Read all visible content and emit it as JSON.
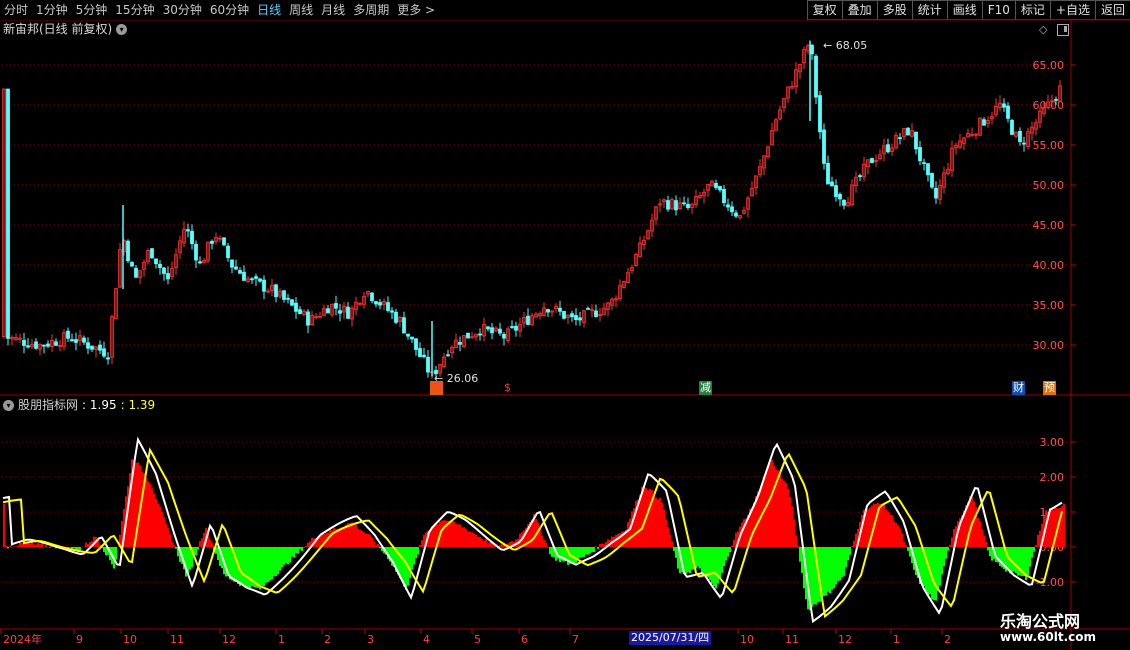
{
  "toolbar": {
    "periods": [
      "分时",
      "1分钟",
      "5分钟",
      "15分钟",
      "30分钟",
      "60分钟",
      "日线",
      "周线",
      "月线",
      "多周期",
      "更多"
    ],
    "active_period": "日线",
    "more_arrow": ">",
    "right_buttons": [
      "复权",
      "叠加",
      "多股",
      "统计",
      "画线",
      "F10",
      "标记",
      "+自选",
      "返回"
    ]
  },
  "stock": {
    "title": "新宙邦(日线 前复权)",
    "high_label": "68.05",
    "low_label": "26.06"
  },
  "events": [
    {
      "label": "激",
      "color": "#ff4040",
      "bg": "#e06000"
    },
    {
      "label": "$",
      "color": "#ff3030",
      "bg": "transparent"
    },
    {
      "label": "减",
      "color": "#ffffff",
      "bg": "#208040"
    },
    {
      "label": "财",
      "color": "#ffffff",
      "bg": "#1050b0"
    },
    {
      "label": "预",
      "color": "#ffffff",
      "bg": "#e07000"
    }
  ],
  "indicator": {
    "name": "股朋指标网",
    "value1": ": 1.95",
    "value2": ": 1.39"
  },
  "price_axis": {
    "ticks": [
      "65.00",
      "60.00",
      "55.00",
      "50.00",
      "45.00",
      "40.00",
      "35.00",
      "30.00"
    ],
    "color": "#ff5050"
  },
  "ind_axis": {
    "ticks": [
      "3.00",
      "2.00",
      "1.00",
      "0.00",
      "-1.00"
    ]
  },
  "date_axis": {
    "labels": [
      "2024年",
      "9",
      "10",
      "11",
      "12",
      "1",
      "2",
      "3",
      "4",
      "5",
      "6",
      "7",
      "10",
      "11",
      "12",
      "1",
      "2"
    ],
    "highlight": "2025/07/31/四"
  },
  "watermark": {
    "line1": "乐淘公式网",
    "line2": "www.60lt.com"
  },
  "colors": {
    "up": "#ff3232",
    "down": "#54ffff",
    "bar_pos": "#ff0000",
    "bar_neg": "#00ff00",
    "line_white": "#ffffff",
    "line_yellow": "#ffff00",
    "grid": "#8a0000"
  },
  "chart_data": [
    {
      "type": "candlestick",
      "title": "新宙邦(日线 前复权)",
      "y_ticks": [
        30,
        35,
        40,
        45,
        50,
        55,
        60,
        65
      ],
      "ylim": [
        25,
        70
      ],
      "anchors_close": [
        [
          "2024-07",
          31
        ],
        [
          "2024-08",
          30
        ],
        [
          "2024-08-mid",
          31
        ],
        [
          "2024-09-end",
          29
        ],
        [
          "2024-10-start",
          44
        ],
        [
          "2024-10",
          38
        ],
        [
          "2024-10-mid",
          42
        ],
        [
          "2024-10-end",
          38
        ],
        [
          "2024-11",
          45
        ],
        [
          "2024-11-mid",
          40
        ],
        [
          "2024-11-end",
          44
        ],
        [
          "2024-12",
          40
        ],
        [
          "2024-12-mid",
          38
        ],
        [
          "2025-01",
          37
        ],
        [
          "2025-01-mid",
          35
        ],
        [
          "2025-02",
          33
        ],
        [
          "2025-02-mid",
          35
        ],
        [
          "2025-03",
          34
        ],
        [
          "2025-03-mid",
          37
        ],
        [
          "2025-04",
          33
        ],
        [
          "2025-04-08",
          26.06
        ],
        [
          "2025-04-mid",
          30
        ],
        [
          "2025-05",
          32
        ],
        [
          "2025-05-mid",
          31
        ],
        [
          "2025-06",
          33
        ],
        [
          "2025-06-mid",
          35
        ],
        [
          "2025-07",
          33
        ],
        [
          "2025-07-mid",
          35
        ],
        [
          "2025-07-end",
          42
        ],
        [
          "2025-08",
          48
        ],
        [
          "2025-08-mid",
          47
        ],
        [
          "2025-09",
          50
        ],
        [
          "2025-09-mid",
          46
        ],
        [
          "2025-10",
          52
        ],
        [
          "2025-10-mid",
          58
        ],
        [
          "2025-10-peak",
          68.05
        ],
        [
          "2025-11",
          51
        ],
        [
          "2025-11-mid",
          48
        ],
        [
          "2025-12",
          53
        ],
        [
          "2025-12-mid",
          55
        ],
        [
          "2026-01",
          57
        ],
        [
          "2026-01-mid",
          48
        ],
        [
          "2026-02",
          55
        ],
        [
          "2026-02-mid",
          57
        ],
        [
          "2026-03",
          60
        ],
        [
          "2026-03-mid",
          55
        ],
        [
          "2026-03-end",
          62
        ]
      ],
      "max_label": 68.05,
      "min_label": 26.06
    },
    {
      "type": "bar+line",
      "title": "股朋指标网",
      "y_ticks": [
        -1,
        0,
        1,
        2,
        3
      ],
      "ylim": [
        -2,
        4
      ],
      "series": [
        {
          "name": "bar",
          "anchors": [
            0,
            0.1,
            0.05,
            0,
            -0.1,
            0.3,
            -0.6,
            2.6,
            1.8,
            0.4,
            -0.9,
            0.6,
            -0.8,
            -1.1,
            -1.2,
            -0.7,
            -0.2,
            0.3,
            0.5,
            0.7,
            0.3,
            -0.3,
            -1.2,
            0.4,
            0.8,
            0.6,
            0.3,
            0,
            0.2,
            0.9,
            -0.3,
            -0.5,
            -0.2,
            0.2,
            0.5,
            1.8,
            1.3,
            -0.8,
            -0.6,
            -1.2,
            0.3,
            1.2,
            2.5,
            1.6,
            -1.8,
            -1.4,
            -0.8,
            1.0,
            1.3,
            0.6,
            -0.9,
            -1.6,
            0.5,
            1.5,
            -0.3,
            -0.7,
            -0.9,
            1.0,
            1.2
          ]
        },
        {
          "name": "white",
          "final": 1.95
        },
        {
          "name": "yellow",
          "final": 1.39
        }
      ]
    }
  ]
}
